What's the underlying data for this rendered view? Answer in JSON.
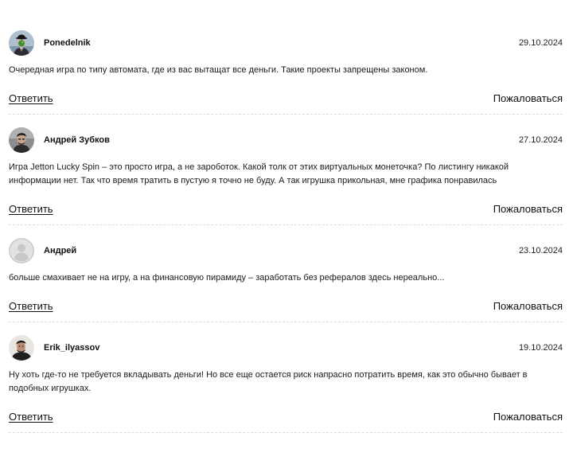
{
  "comments": [
    {
      "author": "Ponedelnik",
      "date": "29.10.2024",
      "text": "Очередная игра по типу автомата, где из вас вытащат все деньги. Такие проекты запрещены законом.",
      "avatar_icon": "bowler-hat-man-avatar"
    },
    {
      "author": "Андрей Зубков",
      "date": "27.10.2024",
      "text": "Игра Jetton Lucky Spin – это просто игра, а не зароботок. Какой толк от этих виртуальных монеточка? По листингу никакой информации нет. Так что время тратить в пустую я точно не буду. А так игрушка прикольная, мне графика понравилась",
      "avatar_icon": "user-photo-avatar"
    },
    {
      "author": "Андрей",
      "date": "23.10.2024",
      "text": "больше смахивает не на игру, а на финансовую пирамиду – заработать без рефералов здесь нереально...",
      "avatar_icon": "default-user-avatar"
    },
    {
      "author": "Erik_ilyassov",
      "date": "19.10.2024",
      "text": "Ну хоть где-то не требуется вкладывать деньги! Но все еще остается риск напрасно потратить время, как это обычно бывает в подобных игрушках.",
      "avatar_icon": "user-photo-avatar"
    }
  ],
  "labels": {
    "reply": "Ответить",
    "report": "Пожаловаться"
  }
}
